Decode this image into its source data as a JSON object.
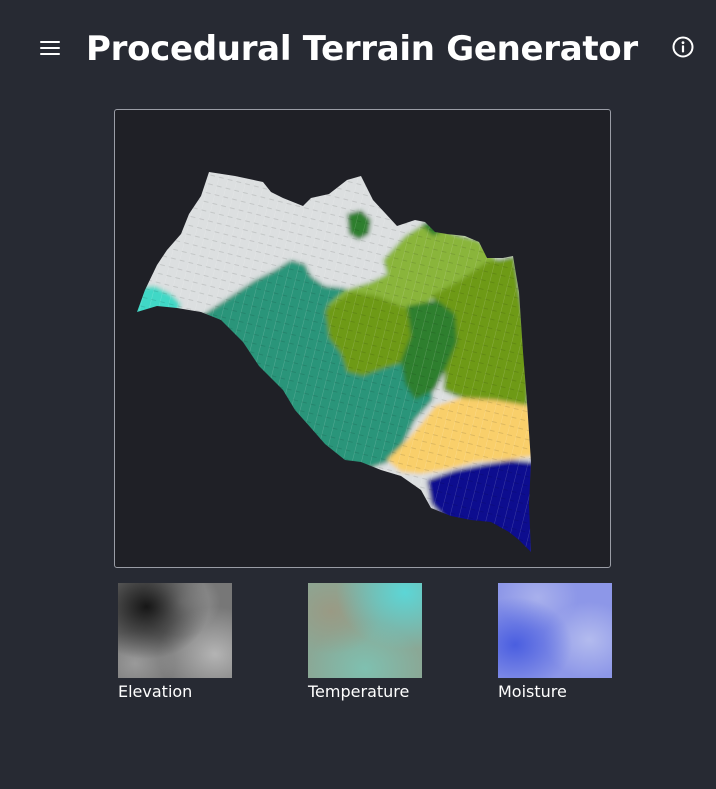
{
  "header": {
    "title": "Procedural Terrain Generator",
    "menu_icon": "hamburger-menu-icon",
    "info_icon": "info-icon"
  },
  "terrain_view": {
    "biome_colors": {
      "snow": "#dcdfe0",
      "shallow_water": "#3fd8c6",
      "rainforest": "#2a957a",
      "forest": "#2f7f2f",
      "grassland": "#8ab53a",
      "savanna": "#6e9a12",
      "desert": "#f9cf6a",
      "ocean": "#0c0d8f"
    }
  },
  "maps": [
    {
      "label": "Elevation",
      "colors": [
        "#161616",
        "#777777",
        "#b4b4b4"
      ]
    },
    {
      "label": "Temperature",
      "colors": [
        "#8a9a86",
        "#5cd6d6",
        "#7fb8a8"
      ]
    },
    {
      "label": "Moisture",
      "colors": [
        "#4a5ee0",
        "#8d97e8",
        "#b3bbee"
      ]
    }
  ]
}
